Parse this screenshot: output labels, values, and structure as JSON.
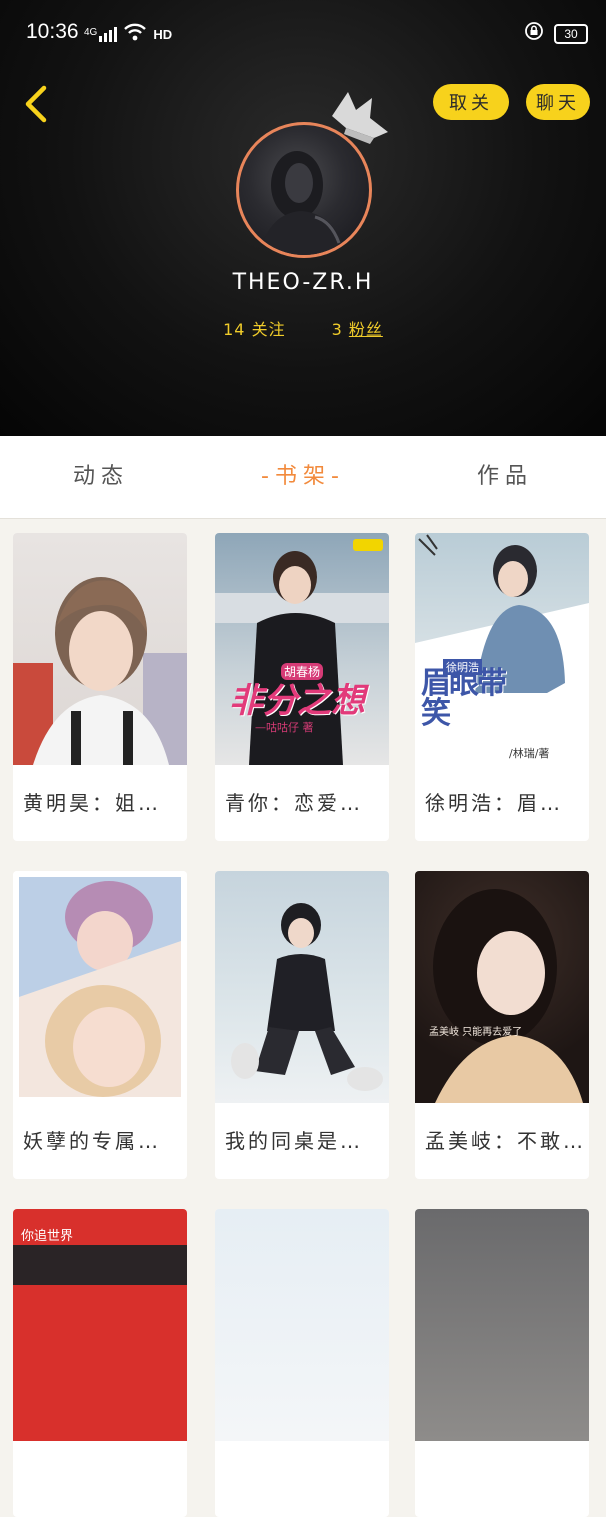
{
  "status_bar": {
    "time": "10:36",
    "network": "4G",
    "hd": "HD",
    "battery": "30"
  },
  "header": {
    "unfollow_label": "取关",
    "chat_label": "聊天",
    "username": "THEO-ZR.H",
    "following_count": "14",
    "following_label": "关注",
    "fans_count": "3",
    "fans_label": "粉丝"
  },
  "tabs": [
    {
      "label": "动态",
      "active": false
    },
    {
      "label": "-书架-",
      "active": true
    },
    {
      "label": "作品",
      "active": false
    }
  ],
  "books": [
    {
      "title": "黄明昊：姐…"
    },
    {
      "title": "青你：恋爱…",
      "cover_title": "非分之想",
      "cover_sub": "胡春杨",
      "cover_author": "—咕咕仔 著"
    },
    {
      "title": "徐明浩：眉…",
      "cover_title": "眉眼带笑",
      "cover_sub": "徐明浩",
      "cover_author": "/林瑞/著"
    },
    {
      "title": "妖孽的专属…"
    },
    {
      "title": "我的同桌是…"
    },
    {
      "title": "孟美岐：不敢…",
      "cover_caption": "孟美岐 只能再去爱了"
    },
    {
      "cover_caption": "你追世界"
    },
    {},
    {}
  ],
  "colors": {
    "accent": "#f28a3c",
    "yellow_button": "#f7d21c",
    "stats_text": "#f0cc2a",
    "avatar_ring": "#e8855a"
  }
}
